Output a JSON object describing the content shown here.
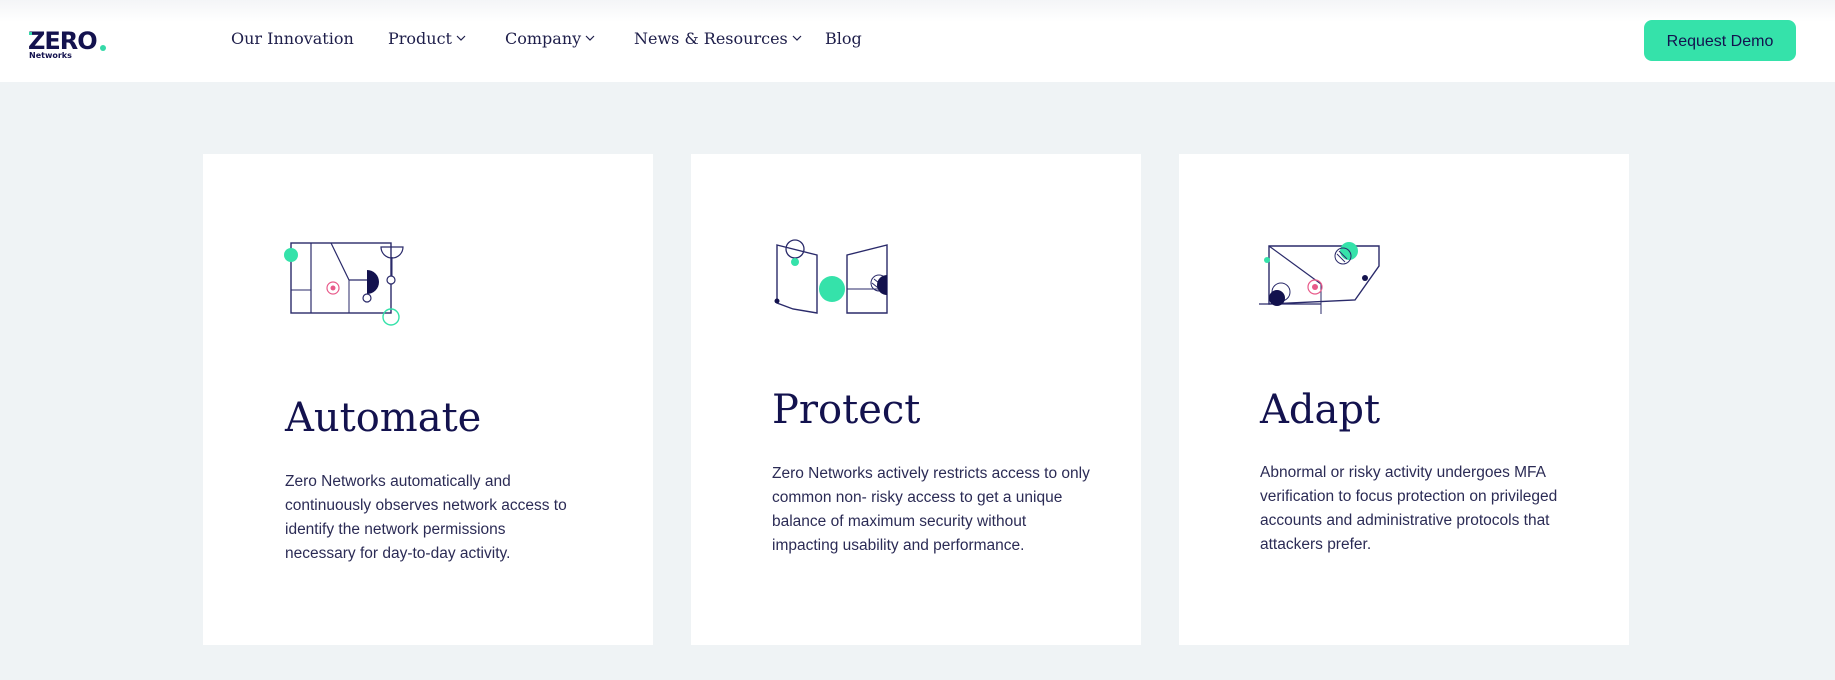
{
  "brand": {
    "name": "ZERO",
    "sub": "Networks"
  },
  "nav": {
    "items": [
      {
        "label": "Our Innovation",
        "dropdown": false
      },
      {
        "label": "Product",
        "dropdown": true
      },
      {
        "label": "Company",
        "dropdown": true
      },
      {
        "label": "News & Resources",
        "dropdown": true
      },
      {
        "label": "Blog",
        "dropdown": false
      }
    ],
    "cta": "Request Demo"
  },
  "cards": [
    {
      "title": "Automate",
      "text": "Zero Networks automatically and continuously observes network access to identify the network permissions necessary for day-to-day activity.",
      "icon": "automate-illustration-icon"
    },
    {
      "title": "Protect",
      "text": "Zero Networks actively restricts access to only common non- risky access to get a unique balance of maximum security without impacting usability and performance.",
      "icon": "protect-illustration-icon"
    },
    {
      "title": "Adapt",
      "text": "Abnormal or risky activity undergoes MFA verification to focus protection on privileged accounts and administrative protocols that attackers prefer.",
      "icon": "adapt-illustration-icon"
    }
  ],
  "colors": {
    "accent": "#35e2aa",
    "navy": "#13124e",
    "page_background": "#eff3f5",
    "card_background": "#ffffff",
    "highlight": "#e85a8a"
  }
}
